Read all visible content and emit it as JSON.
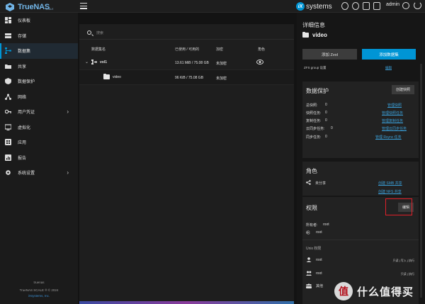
{
  "topbar": {
    "logo_text": "TrueNAS",
    "logo_sub": "SCALE",
    "ixsystems_badge": "iX",
    "ixsystems_text": "systems",
    "user_name": "admin"
  },
  "sidebar": {
    "items": [
      {
        "label": "仪表板",
        "icon": "dashboard-icon"
      },
      {
        "label": "存储",
        "icon": "storage-icon"
      },
      {
        "label": "数据集",
        "icon": "datasets-icon",
        "active": true
      },
      {
        "label": "共享",
        "icon": "shares-icon"
      },
      {
        "label": "数据保护",
        "icon": "data-protection-icon"
      },
      {
        "label": "网络",
        "icon": "network-icon"
      },
      {
        "label": "用户凭证",
        "icon": "credentials-icon",
        "chevron": "›"
      },
      {
        "label": "虚拟化",
        "icon": "virtualization-icon"
      },
      {
        "label": "应用",
        "icon": "apps-icon"
      },
      {
        "label": "报告",
        "icon": "reporting-icon"
      },
      {
        "label": "系统设置",
        "icon": "system-settings-icon",
        "chevron": "›"
      }
    ],
    "footer_host": "truenas",
    "footer_copyright": "TrueNAS SCALE ® © 2024",
    "footer_company": "iXsystems, Inc."
  },
  "main": {
    "search_placeholder": "搜索",
    "columns": [
      "数据集名",
      "已使用 / 可用的",
      "加密",
      "角色"
    ],
    "rows": [
      {
        "chevron": "⌄",
        "name": "vol1",
        "used": "13.61 MiB / 75.08 GB",
        "encryption": "未加密",
        "role_icon": "share-role-icon"
      },
      {
        "name": "video",
        "used": "96 KiB / 75.08 GB",
        "encryption": "未加密",
        "selected": true
      }
    ]
  },
  "details": {
    "title": "详细信息",
    "dataset_name": "video",
    "add_zvol": "添加 Zvol",
    "add_dataset": "添加数据集",
    "cut_row_label": "ZFS group 设置",
    "cut_row_link": "编辑",
    "data_protection": {
      "title": "数据保护",
      "button": "创建快照",
      "rows": [
        {
          "label": "总快照:",
          "value": "0",
          "link": "管理快照"
        },
        {
          "label": "快照任务:",
          "value": "0",
          "link": "管理快照任务"
        },
        {
          "label": "复制任务:",
          "value": "0",
          "link": "管理复制任务"
        },
        {
          "label": "云同步任务:",
          "value": "0",
          "link": "管理云同步任务"
        },
        {
          "label": "同步任务:",
          "value": "0",
          "link": "管理 Rsync 任务"
        }
      ]
    },
    "roles": {
      "title": "角色",
      "status": "未分享",
      "link_smb": "创建 SMB 共享",
      "link_nfs": "创建 NFS 共享"
    },
    "permissions": {
      "title": "权限",
      "button": "编辑",
      "owner_label": "所有者:",
      "owner_value": "root",
      "group_label": "组:",
      "group_value": "root",
      "unix_label": "Unix 权限",
      "entries": [
        {
          "name": "root",
          "perms": "只读 | 写入 | 执行"
        },
        {
          "name": "root",
          "perms": "只读 | 执行"
        },
        {
          "name": "其他",
          "perms": ""
        }
      ]
    }
  },
  "watermark": {
    "badge": "值",
    "text": "什么值得买"
  },
  "colors": {
    "accent": "#0095d5",
    "link": "#3a9fd8",
    "highlight_box": "#e0202a"
  }
}
